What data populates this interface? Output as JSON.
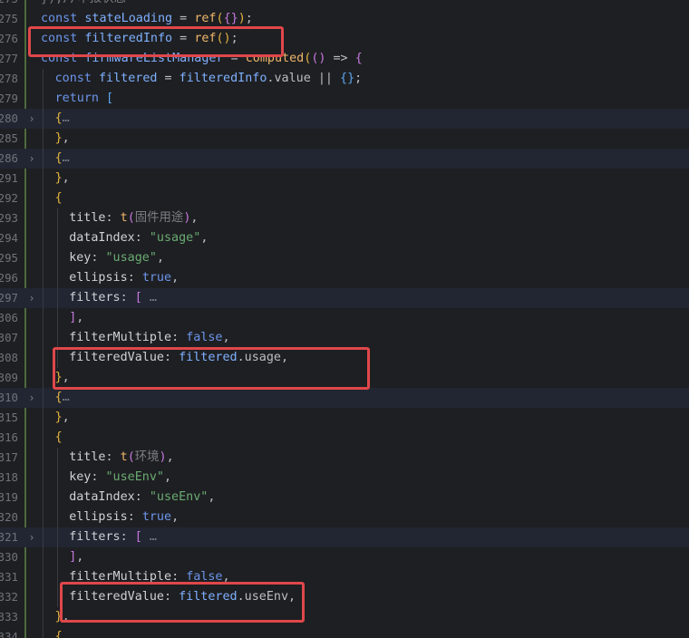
{
  "editor": {
    "lines": [
      {
        "num": "275",
        "segments": [
          [
            "cmt",
            "}"
          ],
          [
            "cmt",
            ");//"
          ],
          [
            "cmt",
            "申报状态"
          ]
        ]
      },
      {
        "num": "275",
        "segments": [
          [
            "kw",
            "const "
          ],
          [
            "var",
            "stateLoading"
          ],
          [
            "plain",
            " = "
          ],
          [
            "fn",
            "ref"
          ],
          [
            "br1",
            "("
          ],
          [
            "br2",
            "{}"
          ],
          [
            "br1",
            ")"
          ],
          [
            "plain",
            ";"
          ]
        ]
      },
      {
        "num": "276",
        "segments": [
          [
            "kw",
            "const "
          ],
          [
            "var",
            "filteredInfo"
          ],
          [
            "plain",
            " = "
          ],
          [
            "fn",
            "ref"
          ],
          [
            "br1",
            "()"
          ],
          [
            "plain",
            ";"
          ]
        ]
      },
      {
        "num": "277",
        "segments": [
          [
            "kw",
            "const "
          ],
          [
            "var",
            "firmwareListManager"
          ],
          [
            "plain",
            " = "
          ],
          [
            "fn",
            "computed"
          ],
          [
            "br1",
            "("
          ],
          [
            "br2",
            "()"
          ],
          [
            "plain",
            " => "
          ],
          [
            "br2",
            "{"
          ]
        ]
      },
      {
        "num": "278",
        "segments": [
          [
            "kw",
            "const "
          ],
          [
            "var",
            "filtered"
          ],
          [
            "plain",
            " = "
          ],
          [
            "var",
            "filteredInfo"
          ],
          [
            "plain",
            ".value || "
          ],
          [
            "br3",
            "{}"
          ],
          [
            "plain",
            ";"
          ]
        ]
      },
      {
        "num": "279",
        "segments": [
          [
            "kw",
            "return "
          ],
          [
            "br3",
            "["
          ]
        ]
      },
      {
        "num": "280",
        "segments": [
          [
            "br1",
            "{"
          ],
          [
            "cmt",
            "…"
          ]
        ]
      },
      {
        "num": "285",
        "segments": [
          [
            "br1",
            "}"
          ],
          [
            "plain",
            ","
          ]
        ]
      },
      {
        "num": "286",
        "segments": [
          [
            "br1",
            "{"
          ],
          [
            "cmt",
            "…"
          ]
        ]
      },
      {
        "num": "291",
        "segments": [
          [
            "br1",
            "}"
          ],
          [
            "plain",
            ","
          ]
        ]
      },
      {
        "num": "292",
        "segments": [
          [
            "br1",
            "{"
          ]
        ]
      },
      {
        "num": "293",
        "segments": [
          [
            "prop",
            "title"
          ],
          [
            "plain",
            ": "
          ],
          [
            "fn",
            "t"
          ],
          [
            "br2",
            "("
          ],
          [
            "cmt",
            "固件用途"
          ],
          [
            "br2",
            ")"
          ],
          [
            "plain",
            ","
          ]
        ]
      },
      {
        "num": "294",
        "segments": [
          [
            "prop",
            "dataIndex"
          ],
          [
            "plain",
            ": "
          ],
          [
            "str",
            "\"usage\""
          ],
          [
            "plain",
            ","
          ]
        ]
      },
      {
        "num": "295",
        "segments": [
          [
            "prop",
            "key"
          ],
          [
            "plain",
            ": "
          ],
          [
            "str",
            "\"usage\""
          ],
          [
            "plain",
            ","
          ]
        ]
      },
      {
        "num": "296",
        "segments": [
          [
            "prop",
            "ellipsis"
          ],
          [
            "plain",
            ": "
          ],
          [
            "val",
            "true"
          ],
          [
            "plain",
            ","
          ]
        ]
      },
      {
        "num": "297",
        "segments": [
          [
            "prop",
            "filters"
          ],
          [
            "plain",
            ": "
          ],
          [
            "br2",
            "["
          ],
          [
            "plain",
            " "
          ],
          [
            "cmt",
            "…"
          ]
        ]
      },
      {
        "num": "306",
        "segments": [
          [
            "br2",
            "]"
          ],
          [
            "plain",
            ","
          ]
        ]
      },
      {
        "num": "307",
        "segments": [
          [
            "prop",
            "filterMultiple"
          ],
          [
            "plain",
            ": "
          ],
          [
            "val",
            "false"
          ],
          [
            "plain",
            ","
          ]
        ]
      },
      {
        "num": "308",
        "segments": [
          [
            "prop",
            "filteredValue"
          ],
          [
            "plain",
            ": "
          ],
          [
            "var",
            "filtered"
          ],
          [
            "plain",
            ".usage,"
          ]
        ]
      },
      {
        "num": "309",
        "segments": [
          [
            "br1",
            "}"
          ],
          [
            "plain",
            ","
          ]
        ]
      },
      {
        "num": "310",
        "segments": [
          [
            "br1",
            "{"
          ],
          [
            "cmt",
            "…"
          ]
        ]
      },
      {
        "num": "315",
        "segments": [
          [
            "br1",
            "}"
          ],
          [
            "plain",
            ","
          ]
        ]
      },
      {
        "num": "316",
        "segments": [
          [
            "br1",
            "{"
          ]
        ]
      },
      {
        "num": "317",
        "segments": [
          [
            "prop",
            "title"
          ],
          [
            "plain",
            ": "
          ],
          [
            "fn",
            "t"
          ],
          [
            "br2",
            "("
          ],
          [
            "cmt",
            "环境"
          ],
          [
            "br2",
            ")"
          ],
          [
            "plain",
            ","
          ]
        ]
      },
      {
        "num": "318",
        "segments": [
          [
            "prop",
            "key"
          ],
          [
            "plain",
            ": "
          ],
          [
            "str",
            "\"useEnv\""
          ],
          [
            "plain",
            ","
          ]
        ]
      },
      {
        "num": "319",
        "segments": [
          [
            "prop",
            "dataIndex"
          ],
          [
            "plain",
            ": "
          ],
          [
            "str",
            "\"useEnv\""
          ],
          [
            "plain",
            ","
          ]
        ]
      },
      {
        "num": "320",
        "segments": [
          [
            "prop",
            "ellipsis"
          ],
          [
            "plain",
            ": "
          ],
          [
            "val",
            "true"
          ],
          [
            "plain",
            ","
          ]
        ]
      },
      {
        "num": "321",
        "segments": [
          [
            "prop",
            "filters"
          ],
          [
            "plain",
            ": "
          ],
          [
            "br2",
            "["
          ],
          [
            "plain",
            " "
          ],
          [
            "cmt",
            "…"
          ]
        ]
      },
      {
        "num": "330",
        "segments": [
          [
            "br2",
            "]"
          ],
          [
            "plain",
            ","
          ]
        ]
      },
      {
        "num": "331",
        "segments": [
          [
            "prop",
            "filterMultiple"
          ],
          [
            "plain",
            ": "
          ],
          [
            "val",
            "false"
          ],
          [
            "plain",
            ","
          ]
        ]
      },
      {
        "num": "332",
        "segments": [
          [
            "prop",
            "filteredValue"
          ],
          [
            "plain",
            ": "
          ],
          [
            "var",
            "filtered"
          ],
          [
            "plain",
            ".useEnv,"
          ]
        ]
      },
      {
        "num": "333",
        "segments": [
          [
            "br1",
            "}"
          ],
          [
            "plain",
            ","
          ]
        ]
      },
      {
        "num": "334",
        "segments": [
          [
            "br1",
            "{"
          ]
        ]
      }
    ],
    "folded_lines": [
      "280",
      "286",
      "297",
      "310",
      "321"
    ],
    "highlighted_lines": [
      "276",
      "308",
      "332"
    ]
  }
}
